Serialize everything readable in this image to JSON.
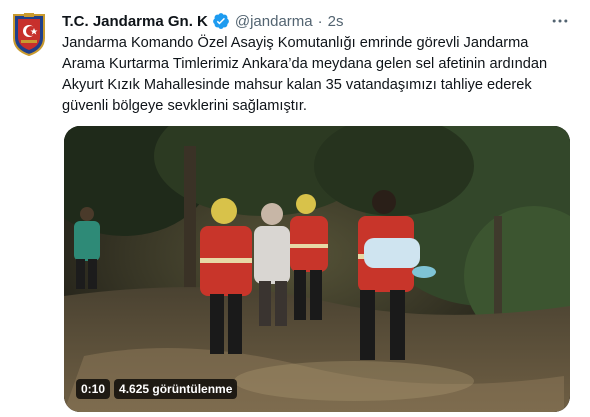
{
  "tweet": {
    "display_name": "T.C. Jandarma Gn. K",
    "handle": "@jandarma",
    "separator": "·",
    "time": "2s",
    "text_lines": [
      "Jandarma Komando Özel Asayiş Komutanlığı emrinde görevli Jandarma",
      "Arama Kurtarma Timlerimiz Ankara’da meydana gelen sel afetinin ardından",
      "Akyurt Kızık Mahallesinde mahsur kalan 35 vatandaşımızı tahliye ederek",
      "güvenli bölgeye sevklerini sağlamıştır."
    ],
    "icons": {
      "avatar": "jandarma-emblem-icon",
      "verified": "verified-badge-icon",
      "more": "more-options-icon"
    }
  },
  "video": {
    "duration": "0:10",
    "views": "4.625 görüntülenme"
  },
  "colors": {
    "text_primary": "#0f1419",
    "text_secondary": "#536471",
    "verified_blue": "#1d9bf0"
  }
}
